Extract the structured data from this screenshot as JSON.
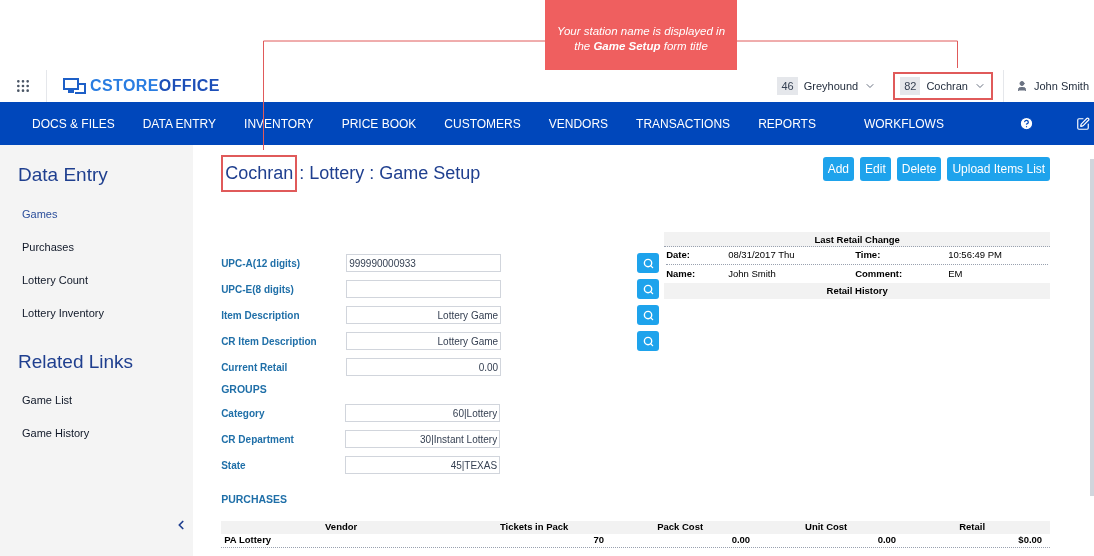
{
  "annotation": {
    "text": "Your station name is displayed in the **Game Setup** form title"
  },
  "header": {
    "logo": [
      "CSTORE",
      "OFFICE"
    ],
    "stations": [
      {
        "number": "46",
        "name": "Greyhound",
        "highlighted": false
      },
      {
        "number": "82",
        "name": "Cochran",
        "highlighted": true
      }
    ],
    "user": "John Smith"
  },
  "nav": [
    "DOCS & FILES",
    "DATA ENTRY",
    "INVENTORY",
    "PRICE BOOK",
    "CUSTOMERS",
    "VENDORS",
    "TRANSACTIONS",
    "REPORTS",
    "WORKFLOWS"
  ],
  "sidebar": [
    {
      "heading": "Data Entry",
      "items": [
        {
          "label": "Games",
          "selected": true
        },
        {
          "label": "Purchases",
          "selected": false
        },
        {
          "label": "Lottery Count",
          "selected": false
        },
        {
          "label": "Lottery Inventory",
          "selected": false
        }
      ]
    },
    {
      "heading": "Related Links",
      "items": [
        {
          "label": "Game List",
          "selected": false
        },
        {
          "label": "Game History",
          "selected": false
        }
      ]
    }
  ],
  "title": {
    "station": "Cochran",
    "rest": ": Lottery : Game Setup",
    "station_highlighted": true
  },
  "buttons": [
    "Add",
    "Edit",
    "Delete",
    "Upload Items List"
  ],
  "fields": [
    {
      "label": "UPC-A(12 digits)",
      "value": "999990000933",
      "kind": "code",
      "searchable": true
    },
    {
      "label": "UPC-E(8 digits)",
      "kind": "code",
      "searchable": true
    },
    {
      "label": "Item Description",
      "value": "Lottery Game",
      "kind": "text",
      "searchable": true
    },
    {
      "label": "CR Item Description",
      "value": "Lottery Game",
      "kind": "text",
      "searchable": true
    },
    {
      "label": "Current Retail",
      "value": "0.00",
      "kind": "text",
      "searchable": false
    }
  ],
  "groups": {
    "heading": "GROUPS",
    "fields": [
      {
        "label": "Category",
        "value": "60|Lottery"
      },
      {
        "label": "CR Department",
        "value": "30|Instant Lottery"
      },
      {
        "label": "State",
        "value": "45|TEXAS"
      }
    ]
  },
  "retail_panel": {
    "title": "Last Retail Change",
    "rows": [
      [
        "Date:",
        "08/31/2017 Thu",
        "Time:",
        "10:56:49 PM"
      ],
      [
        "Name:",
        "John Smith",
        "Comment:",
        "EM"
      ]
    ],
    "footer": "Retail History"
  },
  "purchases": {
    "heading": "PURCHASES",
    "columns": [
      "Vendor",
      "Tickets in Pack",
      "Pack Cost",
      "Unit Cost",
      "Retail"
    ],
    "rows": [
      [
        "PA Lottery",
        "70",
        "0.00",
        "0.00",
        "$0.00"
      ]
    ]
  }
}
